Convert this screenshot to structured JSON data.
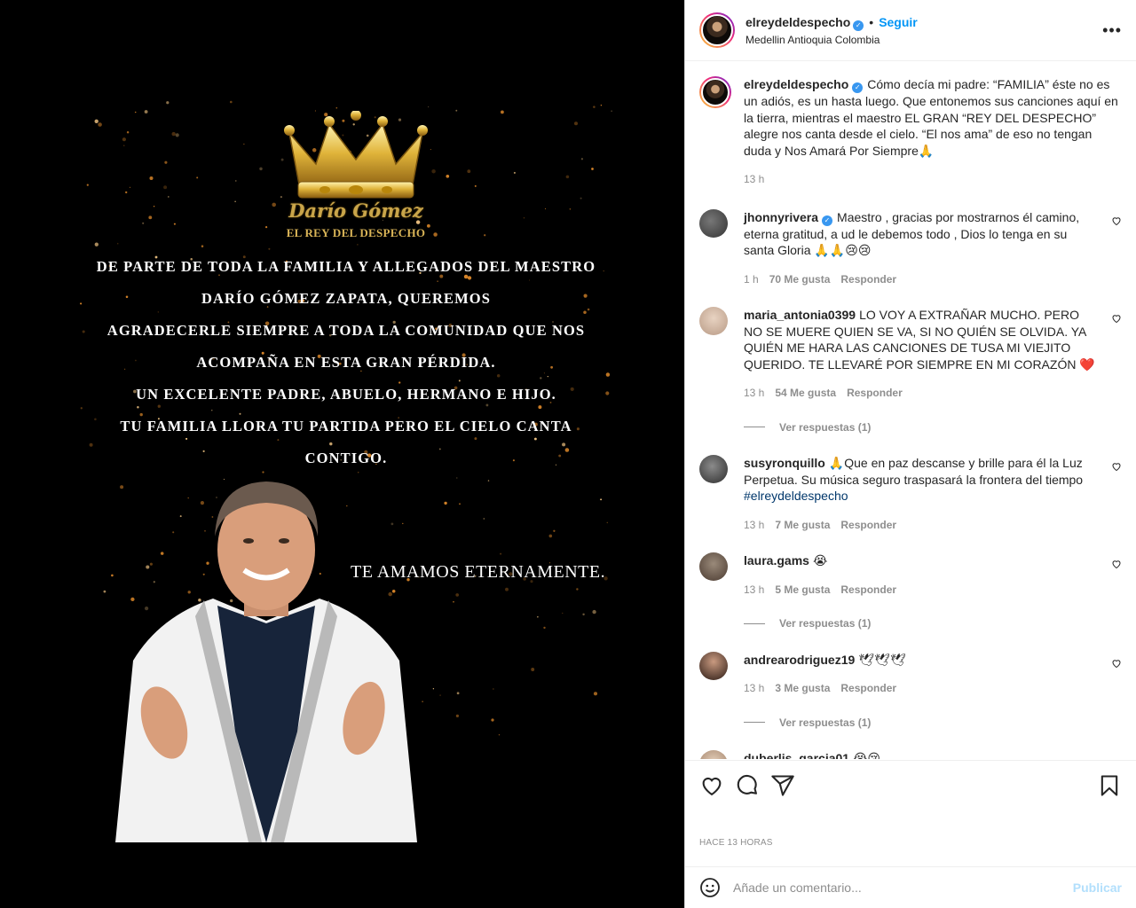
{
  "post": {
    "image": {
      "brand_name": "Darío Gómez",
      "brand_subtitle": "EL REY DEL DESPECHO",
      "message_lines": [
        "DE PARTE DE TODA LA FAMILIA Y ALLEGADOS DEL MAESTRO",
        "DARÍO GÓMEZ ZAPATA, QUEREMOS",
        "AGRADECERLE SIEMPRE A TODA LA COMUNIDAD QUE NOS",
        "ACOMPAÑA EN ESTA GRAN PÉRDIDA.",
        "UN EXCELENTE PADRE, ABUELO, HERMANO E HIJO.",
        "TU FAMILIA LLORA TU PARTIDA PERO EL CIELO CANTA CONTIGO."
      ],
      "closing": "TE AMAMOS ETERNAMENTE."
    },
    "header": {
      "username": "elreydeldespecho",
      "follow_label": "Seguir",
      "separator": "•",
      "location": "Medellin Antioquia Colombia",
      "more_label": "•••"
    },
    "caption": {
      "username": "elreydeldespecho",
      "text": "Cómo decía mi padre: “FAMILIA” éste no es un adiós, es un hasta luego. Que entonemos sus canciones aquí en la tierra, mientras el maestro EL GRAN “REY DEL DESPECHO” alegre nos canta desde el cielo. “El nos ama” de eso no tengan duda y Nos Amará Por Siempre🙏",
      "time": "13 h"
    },
    "comments": [
      {
        "username": "jhonnyrivera",
        "verified": true,
        "text": "Maestro , gracias por mostrarnos él camino, eterna gratitud, a ud le debemos todo , Dios lo tenga en su santa Gloria 🙏🙏😢😢",
        "time": "1 h",
        "likes": "70 Me gusta",
        "reply": "Responder",
        "view_replies": ""
      },
      {
        "username": "maria_antonia0399",
        "verified": false,
        "text": "LO VOY A EXTRAÑAR MUCHO. PERO NO SE MUERE QUIEN SE VA, SI NO QUIÉN SE OLVIDA. YA QUIÉN ME HARA LAS CANCIONES DE TUSA MI VIEJITO QUERIDO. TE LLEVARÉ POR SIEMPRE EN MI CORAZÓN ❤️",
        "time": "13 h",
        "likes": "54 Me gusta",
        "reply": "Responder",
        "view_replies": "Ver respuestas (1)"
      },
      {
        "username": "susyronquillo",
        "verified": false,
        "text": "🙏Que en paz descanse y brille para él la Luz Perpetua. Su música seguro traspasará la frontera del tiempo",
        "hashtag": "#elreydeldespecho",
        "time": "13 h",
        "likes": "7 Me gusta",
        "reply": "Responder",
        "view_replies": ""
      },
      {
        "username": "laura.gams",
        "verified": false,
        "text": "😭",
        "time": "13 h",
        "likes": "5 Me gusta",
        "reply": "Responder",
        "view_replies": "Ver respuestas (1)"
      },
      {
        "username": "andrearodriguez19",
        "verified": false,
        "text": "🕊🕊🕊",
        "time": "13 h",
        "likes": "3 Me gusta",
        "reply": "Responder",
        "view_replies": "Ver respuestas (1)"
      },
      {
        "username": "duberlis_garcia01",
        "verified": false,
        "text": "😭😢",
        "time": "",
        "likes": "",
        "reply": "",
        "view_replies": ""
      }
    ],
    "footer": {
      "timestamp": "HACE 13 HORAS",
      "comment_placeholder": "Añade un comentario...",
      "publish_label": "Publicar"
    }
  },
  "colors": {
    "accent": "#0095f6",
    "text": "#262626",
    "muted": "#8e8e8e",
    "like_red": "#ed4956"
  }
}
